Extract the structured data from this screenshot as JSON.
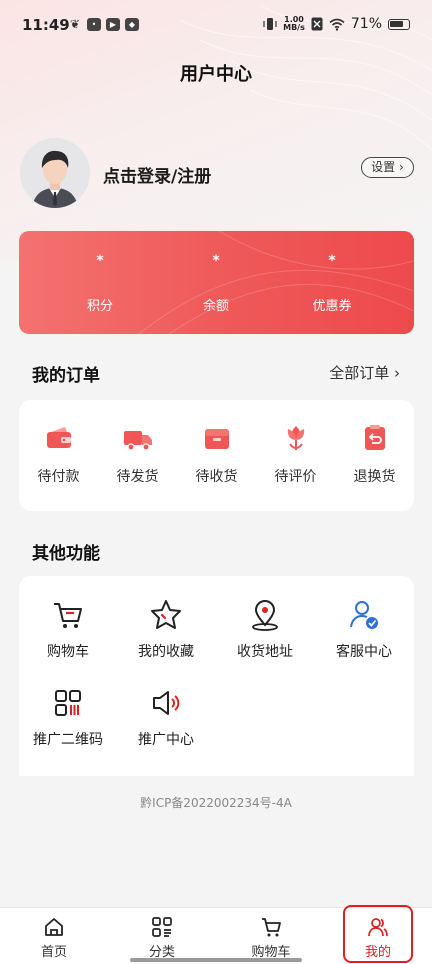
{
  "status_bar": {
    "time": "11:49",
    "net_speed_value": "1.00",
    "net_speed_unit": "MB/s",
    "battery": "71%"
  },
  "header": {
    "title": "用户中心"
  },
  "user": {
    "login_text": "点击登录/注册",
    "settings_label": "设置"
  },
  "stats": [
    {
      "value": "*",
      "label": "积分"
    },
    {
      "value": "*",
      "label": "余额"
    },
    {
      "value": "*",
      "label": "优惠券"
    }
  ],
  "orders": {
    "title": "我的订单",
    "all_link": "全部订单",
    "items": [
      {
        "label": "待付款",
        "icon": "wallet-icon"
      },
      {
        "label": "待发货",
        "icon": "truck-icon"
      },
      {
        "label": "待收货",
        "icon": "box-icon"
      },
      {
        "label": "待评价",
        "icon": "flower-icon"
      },
      {
        "label": "退换货",
        "icon": "return-icon"
      }
    ]
  },
  "functions": {
    "title": "其他功能",
    "items": [
      {
        "label": "购物车",
        "icon": "cart-icon"
      },
      {
        "label": "我的收藏",
        "icon": "star-icon"
      },
      {
        "label": "收货地址",
        "icon": "location-icon"
      },
      {
        "label": "客服中心",
        "icon": "customer-service-icon"
      },
      {
        "label": "推广二维码",
        "icon": "qrcode-icon"
      },
      {
        "label": "推广中心",
        "icon": "speaker-icon"
      }
    ]
  },
  "footer": {
    "icp": "黔ICP备2022002234号-4A"
  },
  "nav": {
    "items": [
      {
        "label": "首页",
        "icon": "home-icon"
      },
      {
        "label": "分类",
        "icon": "category-icon"
      },
      {
        "label": "购物车",
        "icon": "cart-icon"
      },
      {
        "label": "我的",
        "icon": "user-icon",
        "active": true
      }
    ]
  },
  "colors": {
    "accent": "#e02020",
    "card_red": "#ef5a5a",
    "background": "#f4f4f4"
  }
}
